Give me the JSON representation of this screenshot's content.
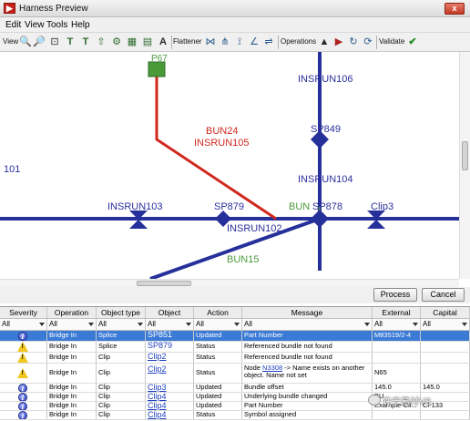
{
  "window": {
    "title": "Harness Preview",
    "icon": "app-icon",
    "close_glyph": "x"
  },
  "menu": [
    {
      "label": "Edit"
    },
    {
      "label": "View"
    },
    {
      "label": "Tools"
    },
    {
      "label": "Help"
    }
  ],
  "toolbar": {
    "view_label": "View",
    "flattener_label": "Flattener",
    "operations_label": "Operations",
    "validate_label": "Validate",
    "accent": "#1a8c1a"
  },
  "canvas": {
    "labels": {
      "p67": "P67",
      "insrun106": "INSRUN106",
      "bun24": "BUN24",
      "insrun105": "INSRUN105",
      "sp849": "SP849",
      "num101": "101",
      "insrun104": "INSRUN104",
      "insrun103": "INSRUN103",
      "sp879": "SP879",
      "bun": "BUN",
      "sp878": "SP878",
      "clip3": "Clip3",
      "insrun102": "INSRUN102",
      "bun15": "BUN15"
    },
    "colors": {
      "blue": "#26309a",
      "red": "#d1271d",
      "green": "#4a9a3a",
      "label_blue": "#2b2f9c"
    }
  },
  "buttons": {
    "process": "Process",
    "cancel": "Cancel"
  },
  "grid": {
    "columns": [
      "Severity",
      "Operation",
      "Object type",
      "Object",
      "Action",
      "Message",
      "External",
      "Capital"
    ],
    "filter_value": "All",
    "rows": [
      {
        "severity": "info",
        "operation": "Bridge In",
        "object_type": "Splice",
        "object": "SP851",
        "action": "Updated",
        "message": "Part Number",
        "external": "M83519/2-4",
        "capital": "",
        "selected": true
      },
      {
        "severity": "warning",
        "operation": "Bridge In",
        "object_type": "Splice",
        "object": "SP879",
        "action": "Status",
        "message": "Referenced bundle not found",
        "external": "",
        "capital": ""
      },
      {
        "severity": "warning",
        "operation": "Bridge In",
        "object_type": "Clip",
        "object": "Clip2",
        "action": "Status",
        "message": "Referenced bundle not found",
        "external": "",
        "capital": ""
      },
      {
        "severity": "warning",
        "operation": "Bridge In",
        "object_type": "Clip",
        "object": "Clip2",
        "action": "Status",
        "message_line1_prefix": "Node ",
        "message_link": "N3308",
        "message_line1_suffix": " -> Name exists on another",
        "message_line2": "object. Name not set",
        "external": "N65",
        "capital": ""
      },
      {
        "severity": "info",
        "operation": "Bridge In",
        "object_type": "Clip",
        "object": "Clip3",
        "action": "Updated",
        "message": "Bundle offset",
        "external": "145.0",
        "capital": "145.0"
      },
      {
        "severity": "info",
        "operation": "Bridge In",
        "object_type": "Clip",
        "object": "Clip4",
        "action": "Updated",
        "message": "Underlying bundle changed",
        "external": "BU",
        "capital": ""
      },
      {
        "severity": "info",
        "operation": "Bridge In",
        "object_type": "Clip",
        "object": "Clip4",
        "action": "Updated",
        "message": "Part Number",
        "external": "Example-Cli...",
        "capital": "Cl-133"
      },
      {
        "severity": "info",
        "operation": "Bridge In",
        "object_type": "Clip",
        "object": "Clip4",
        "action": "Status",
        "message": "Symbol assigned",
        "external": "",
        "capital": ""
      }
    ]
  },
  "watermark": "许宁易付VS"
}
